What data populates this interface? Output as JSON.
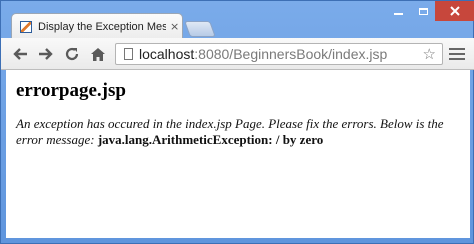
{
  "browser": {
    "tab_title": "Display the Exception Mes",
    "tab_close": "×",
    "url_host": "localhost",
    "url_rest": ":8080/BeginnersBook/index.jsp",
    "icons": [
      "back-arrow-icon",
      "forward-arrow-icon",
      "reload-icon",
      "home-icon",
      "page-icon",
      "star-icon",
      "menu-icon"
    ],
    "close_color": "#c7473c"
  },
  "page": {
    "heading": "errorpage.jsp",
    "message_prefix": "An exception has occured in the index.jsp Page. Please fix the errors. Below is the error message:",
    "exception": "java.lang.ArithmeticException: / by zero"
  }
}
